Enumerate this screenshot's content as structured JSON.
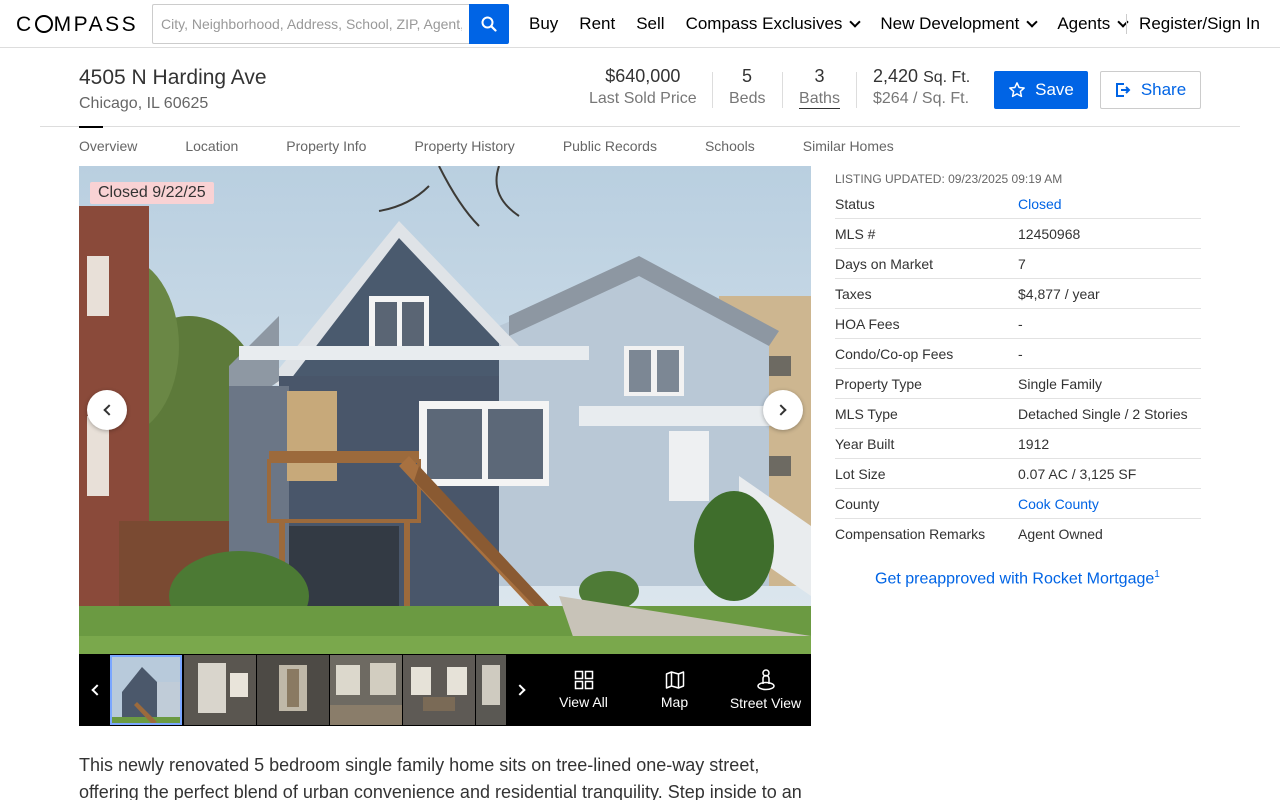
{
  "nav": {
    "logo": "COMPASS",
    "search_placeholder": "City, Neighborhood, Address, School, ZIP, Agent, ID",
    "links": [
      "Buy",
      "Rent",
      "Sell",
      "Compass Exclusives",
      "New Development",
      "Agents"
    ],
    "signin": "Register/Sign In"
  },
  "header": {
    "address": "4505 N Harding Ave",
    "citystate": "Chicago, IL 60625",
    "price": "$640,000",
    "price_label": "Last Sold Price",
    "beds": "5",
    "beds_label": "Beds",
    "baths": "3",
    "baths_label": "Baths",
    "sqft": "2,420",
    "sqft_unit": "Sq. Ft.",
    "price_per_sqft": "$264 / Sq. Ft.",
    "save": "Save",
    "share": "Share"
  },
  "tabs": [
    "Overview",
    "Location",
    "Property Info",
    "Property History",
    "Public Records",
    "Schools",
    "Similar Homes"
  ],
  "photo": {
    "badge": "Closed 9/22/25",
    "actions": {
      "view_all": "View All",
      "map": "Map",
      "street_view": "Street View"
    }
  },
  "facts": {
    "updated": "LISTING UPDATED: 09/23/2025 09:19 AM",
    "rows": [
      {
        "k": "Status",
        "v": "Closed"
      },
      {
        "k": "MLS #",
        "v": "12450968"
      },
      {
        "k": "Days on Market",
        "v": "7"
      },
      {
        "k": "Taxes",
        "v": "$4,877 / year"
      },
      {
        "k": "HOA Fees",
        "v": "-"
      },
      {
        "k": "Condo/Co-op Fees",
        "v": "-"
      },
      {
        "k": "Property Type",
        "v": "Single Family"
      },
      {
        "k": "MLS Type",
        "v": "Detached Single / 2 Stories"
      },
      {
        "k": "Year Built",
        "v": "1912"
      },
      {
        "k": "Lot Size",
        "v": "0.07 AC / 3,125 SF"
      },
      {
        "k": "County",
        "v": "Cook County"
      },
      {
        "k": "Compensation Remarks",
        "v": "Agent Owned"
      }
    ],
    "preapproved": "Get preapproved with Rocket Mortgage",
    "preapproved_sup": "1"
  },
  "description": "This newly renovated 5 bedroom single family home sits on tree-lined one-way street, offering the perfect blend of urban convenience and residential tranquility. Step inside to an",
  "colors": {
    "accent": "#0064e5",
    "badge_bg": "#f9d2d4"
  }
}
